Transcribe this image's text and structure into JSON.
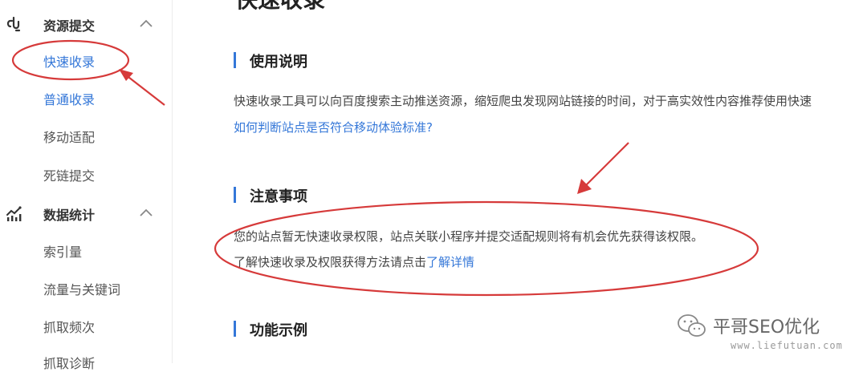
{
  "sidebar": {
    "groups": [
      {
        "label": "资源提交",
        "icon": "link-icon",
        "expanded": true,
        "items": [
          {
            "label": "快速收录",
            "active": true
          },
          {
            "label": "普通收录"
          },
          {
            "label": "移动适配"
          },
          {
            "label": "死链提交"
          }
        ]
      },
      {
        "label": "数据统计",
        "icon": "stats-chart-icon",
        "expanded": true,
        "items": [
          {
            "label": "索引量"
          },
          {
            "label": "流量与关键词"
          },
          {
            "label": "抓取频次"
          },
          {
            "label": "抓取诊断"
          }
        ]
      }
    ]
  },
  "main": {
    "page_title": "快速收录",
    "sections": [
      {
        "title": "使用说明",
        "paragraph": "快速收录工具可以向百度搜索主动推送资源，缩短爬虫发现网站链接的时间，对于高实效性内容推荐使用快速",
        "link": "如何判断站点是否符合移动体验标准?"
      },
      {
        "title": "注意事项",
        "paragraph": "您的站点暂无快速收录权限，站点关联小程序并提交适配规则将有机会优先获得该权限。",
        "paragraph2_prefix": "了解快速收录及权限获得方法请点击",
        "paragraph2_link": "了解详情"
      },
      {
        "title": "功能示例"
      }
    ]
  },
  "watermark": {
    "title": "平哥SEO优化",
    "url": "www.liefutuan.com",
    "icon": "wechat-icon"
  },
  "colors": {
    "accent": "#3477d8",
    "annotation_red": "#d63a3a",
    "text": "#333333"
  }
}
